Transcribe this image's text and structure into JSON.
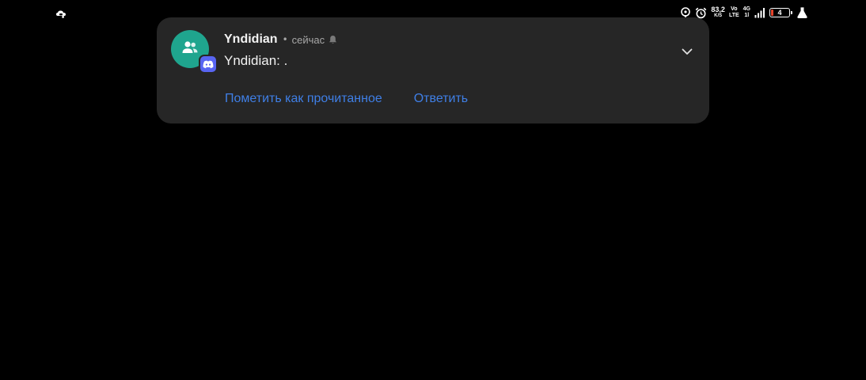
{
  "status_bar": {
    "left_icon": "cloud-game-icon",
    "icons": [
      "location-icon",
      "alarm-icon"
    ],
    "speed_value": "83,2",
    "speed_unit": "K/S",
    "volte_top": "Vo",
    "volte_bottom": "LTE",
    "network_type": "4G",
    "network_sub": "1l",
    "signal_icon": "signal-icon",
    "battery_percent": 4,
    "battery_label": "4",
    "battery_color": "#e8452c",
    "extra_icon": "flask-icon"
  },
  "notification": {
    "app_icon": "discord-icon",
    "avatar_icon": "group-users-icon",
    "avatar_color": "#1fa58e",
    "badge_color": "#5865f2",
    "sender": "Yndidian",
    "separator": "•",
    "time": "сейчас",
    "muted_icon": "bell-icon",
    "message": "Yndidian: .",
    "expand_icon": "chevron-down-icon",
    "actions": [
      {
        "label": "Пометить как прочитанное"
      },
      {
        "label": "Ответить"
      }
    ],
    "action_color": "#3f7fe6"
  }
}
